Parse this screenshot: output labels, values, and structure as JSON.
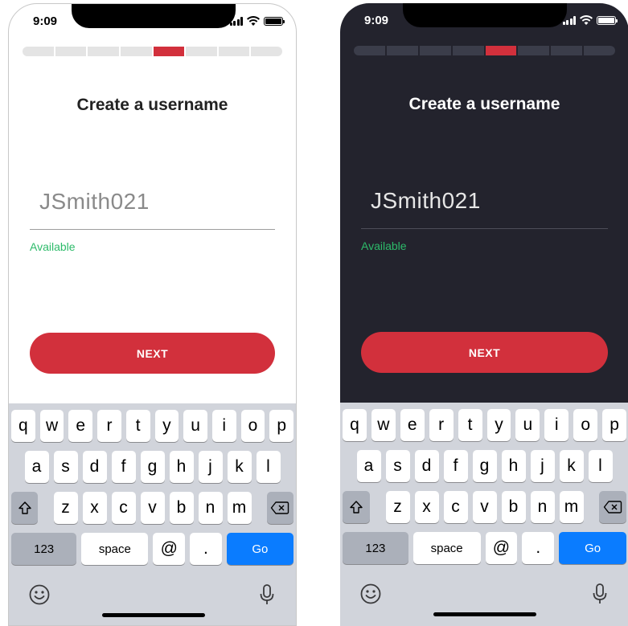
{
  "status_bar": {
    "time": "9:09"
  },
  "progress": {
    "total_steps": 8,
    "current_step": 5
  },
  "screen": {
    "title": "Create a username",
    "username_value": "JSmith021",
    "availability_status": "Available",
    "next_button_label": "NEXT"
  },
  "colors": {
    "accent": "#d2303c",
    "available": "#2dbb6a",
    "dark_background": "#23232d",
    "go_key": "#0a7cff"
  },
  "keyboard": {
    "row1": [
      "q",
      "w",
      "e",
      "r",
      "t",
      "y",
      "u",
      "i",
      "o",
      "p"
    ],
    "row2": [
      "a",
      "s",
      "d",
      "f",
      "g",
      "h",
      "j",
      "k",
      "l"
    ],
    "row3": [
      "z",
      "x",
      "c",
      "v",
      "b",
      "n",
      "m"
    ],
    "numbers_key": "123",
    "space_key": "space",
    "at_key": "@",
    "dot_key": ".",
    "go_key": "Go",
    "icons": {
      "shift": "shift-icon",
      "delete": "delete-icon",
      "emoji": "emoji-icon",
      "mic": "microphone-icon"
    }
  }
}
